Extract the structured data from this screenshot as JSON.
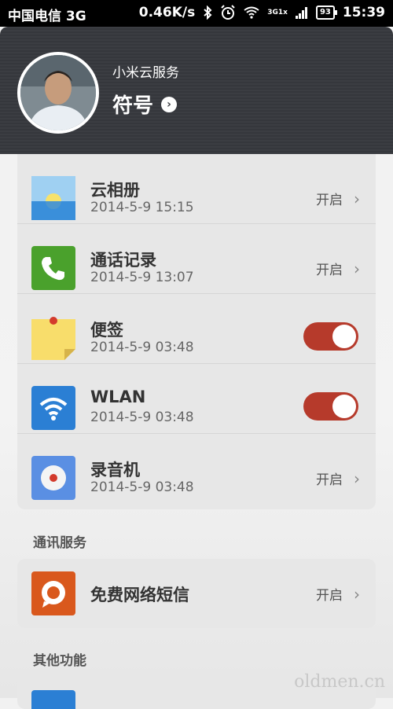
{
  "status_bar": {
    "carrier": "中国电信 3G",
    "speed": "0.46K/s",
    "network_top": "3G",
    "network_bottom": "1x",
    "battery": "93",
    "time": "15:39"
  },
  "header": {
    "service": "小米云服务",
    "user_name": "符号"
  },
  "sync_items": [
    {
      "title": "云相册",
      "date": "2014-5-9 15:15",
      "action": "开启",
      "icon": "photo-album-icon"
    },
    {
      "title": "通话记录",
      "date": "2014-5-9 13:07",
      "action": "开启",
      "icon": "phone-icon"
    },
    {
      "title": "便签",
      "date": "2014-5-9 03:48",
      "toggle_on": true,
      "icon": "notes-icon"
    },
    {
      "title": "WLAN",
      "date": "2014-5-9 03:48",
      "toggle_on": true,
      "icon": "wifi-icon"
    },
    {
      "title": "录音机",
      "date": "2014-5-9 03:48",
      "action": "开启",
      "icon": "recorder-icon"
    }
  ],
  "sections": {
    "comm": "通讯服务",
    "other": "其他功能"
  },
  "comm_items": [
    {
      "title": "免费网络短信",
      "action": "开启",
      "icon": "sms-icon"
    }
  ],
  "watermark": "oldmen.cn",
  "colors": {
    "toggle_on": "#b63a2b",
    "header_bg": "#3b3d42"
  }
}
